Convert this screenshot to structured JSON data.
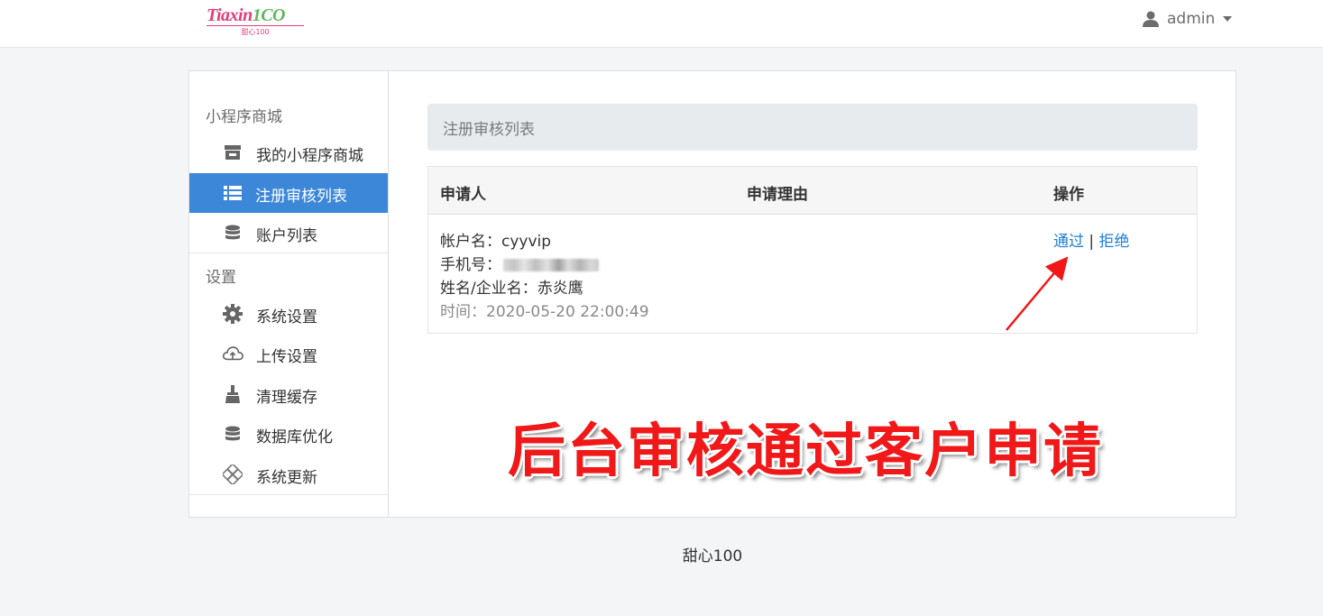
{
  "brand": {
    "logo_text": "Tiaxin",
    "logo_num": "1CO",
    "logo_sub": "甜心100"
  },
  "user": {
    "name": "admin",
    "icon": "user-icon",
    "caret_icon": "caret-down-icon"
  },
  "sidebar": {
    "groups": [
      {
        "title": "小程序商城"
      },
      {
        "title": "设置"
      }
    ],
    "items": [
      {
        "label": "我的小程序商城",
        "icon": "store-icon"
      },
      {
        "label": "注册审核列表",
        "icon": "list-icon",
        "active": true
      },
      {
        "label": "账户列表",
        "icon": "database-icon"
      },
      {
        "label": "系统设置",
        "icon": "gear-icon"
      },
      {
        "label": "上传设置",
        "icon": "cloud-upload-icon"
      },
      {
        "label": "清理缓存",
        "icon": "broom-icon"
      },
      {
        "label": "数据库优化",
        "icon": "database-icon"
      },
      {
        "label": "系统更新",
        "icon": "update-icon"
      }
    ]
  },
  "main": {
    "header_title": "注册审核列表",
    "table": {
      "columns": [
        "申请人",
        "申请理由",
        "操作"
      ],
      "rows": [
        {
          "account_label": "帐户名：cyyvip",
          "phone_label": "手机号：",
          "name_label": "姓名/企业名：赤炎鹰",
          "time_label": "时间：2020-05-20 22:00:49",
          "reason": "",
          "actions": {
            "approve": "通过",
            "separator": "|",
            "reject": "拒绝"
          }
        }
      ]
    }
  },
  "annotation": {
    "text": "后台审核通过客户申请",
    "color": "#f01818"
  },
  "footer": {
    "text": "甜心100"
  },
  "colors": {
    "accent": "#3d87d9",
    "link": "#1e7ed6",
    "brand_pink": "#e23c7a"
  }
}
